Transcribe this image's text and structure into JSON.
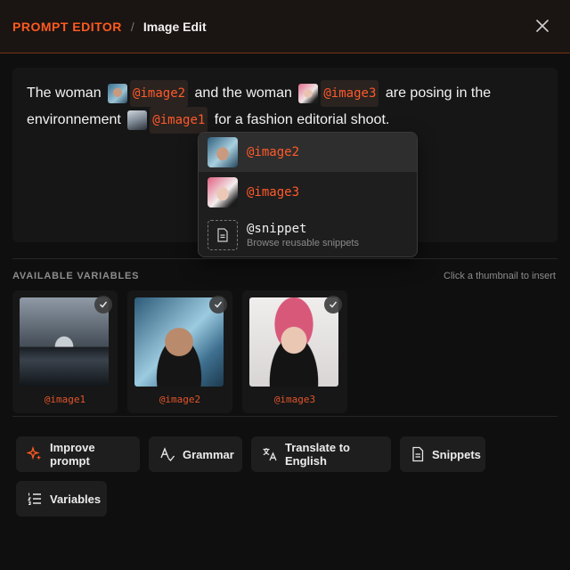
{
  "header": {
    "title": "PROMPT EDITOR",
    "separator": "/",
    "subtitle": "Image Edit",
    "close_icon": "close-icon"
  },
  "prompt": {
    "seg1": "The woman",
    "tok1": "@image2",
    "seg2": "and the woman",
    "tok2": "@image3",
    "seg3": "are posing in the environnement",
    "tok3": "@image1",
    "seg4": "for a fashion editorial shoot."
  },
  "dropdown": {
    "items": [
      {
        "label": "@image2",
        "active": true
      },
      {
        "label": "@image3",
        "active": false
      }
    ],
    "snippet": {
      "title": "@snippet",
      "subtitle": "Browse reusable snippets",
      "icon": "document-icon"
    }
  },
  "variables": {
    "heading": "AVAILABLE VARIABLES",
    "hint": "Click a thumbnail to insert",
    "cards": [
      {
        "label": "@image1",
        "checked": true
      },
      {
        "label": "@image2",
        "checked": true
      },
      {
        "label": "@image3",
        "checked": true
      }
    ]
  },
  "actions": [
    {
      "label": "Improve prompt",
      "icon": "sparkle-icon"
    },
    {
      "label": "Grammar",
      "icon": "grammar-icon"
    },
    {
      "label": "Translate to English",
      "icon": "translate-icon"
    },
    {
      "label": "Snippets",
      "icon": "document-icon"
    },
    {
      "label": "Variables",
      "icon": "list-icon"
    }
  ],
  "colors": {
    "accent": "#ff5a1f",
    "token": "#ff5a2a",
    "background": "#0f0f0f",
    "header_border": "#7a3412"
  }
}
